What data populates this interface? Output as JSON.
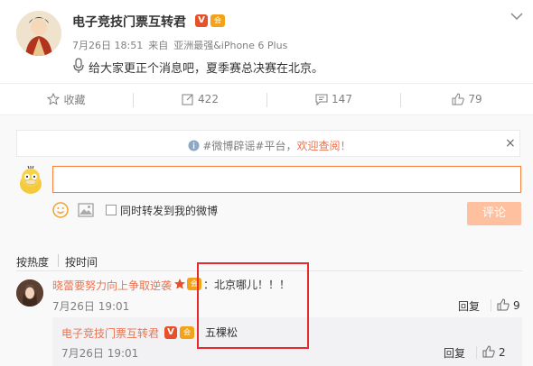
{
  "post": {
    "author": "电子竞技门票互转君",
    "verified_badge": "V",
    "member_badge": "会",
    "time": "7月26日 18:51",
    "source_prefix": "来自",
    "source": "亚洲最强&iPhone 6 Plus",
    "text": "给大家更正个消息吧，夏季赛总决赛在北京。"
  },
  "actions": {
    "favorite": "收藏",
    "repost": "422",
    "comment": "147",
    "like": "79"
  },
  "notice": {
    "hashtag": "#微博辟谣#",
    "platform": "平台，",
    "welcome": "欢迎查阅！",
    "close": "×"
  },
  "composer": {
    "input_value": "",
    "repost_label": "同时转发到我的微博",
    "submit_label": "评论"
  },
  "sort": {
    "hot": "按热度",
    "time": "按时间"
  },
  "comment": {
    "author": "晓蕾要努力向上争取逆袭",
    "text": "：北京哪儿！！！",
    "time": "7月26日 19:01",
    "reply_label": "回复",
    "likes": "9"
  },
  "reply": {
    "author": "电子竞技门票互转君",
    "verified_badge": "V",
    "member_badge": "会",
    "text": "五棵松",
    "time": "7月26日 19:01",
    "reply_label": "回复",
    "likes": "2"
  },
  "colors": {
    "accent": "#eb7350",
    "highlight_box": "#e52b2b",
    "submit_disabled": "#ffc09f"
  }
}
